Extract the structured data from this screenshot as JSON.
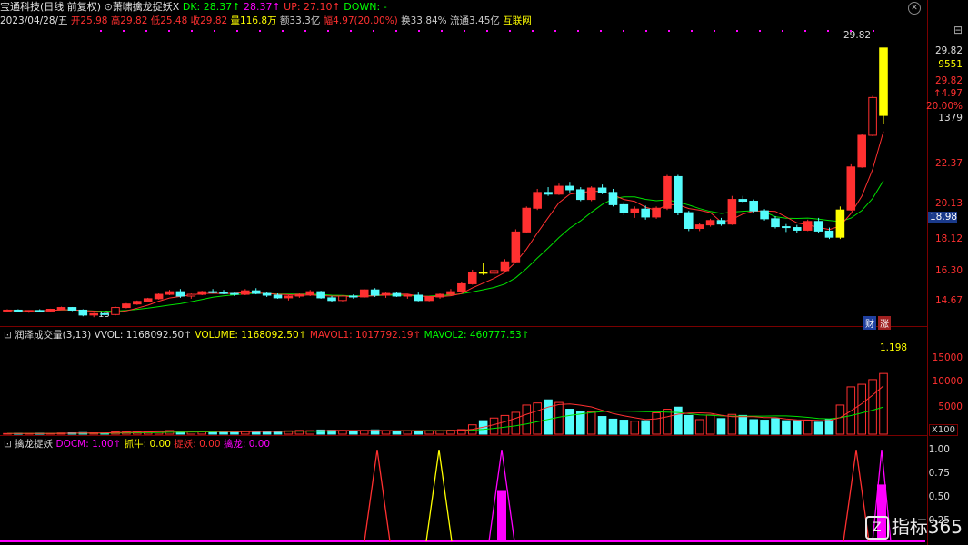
{
  "colors": {
    "up": "#ff3030",
    "down": "#54fcfc",
    "yellow": "#ffff00",
    "magenta": "#ff00ff",
    "green": "#00ff00",
    "grid": "#7a0000",
    "ma1": "#ff3030",
    "ma2": "#00e000"
  },
  "header": {
    "stock": "宝通科技",
    "period": "(日线 前复权)",
    "indicator": "萧啸擒龙捉妖X",
    "dk": "DK: 28.37↑",
    "dk2": "28.37↑",
    "up": "UP: 27.10↑",
    "down": "DOWN: -",
    "date": "2023/04/28/五",
    "open": "开25.98",
    "high": "高29.82",
    "low": "低25.48",
    "close": "收29.82",
    "vol": "量116.8万",
    "amount": "额33.3亿",
    "range": "幅4.97(20.00%)",
    "turnover": "换33.84%",
    "float": "流通3.45亿",
    "sector": "互联网"
  },
  "price_axis": {
    "ticks": [
      "29.82",
      "9551",
      "29.82",
      "↑4.97",
      "20.00%",
      "1379",
      "22.37",
      "20.13",
      "18.12",
      "16.30",
      "14.67"
    ],
    "current": "18.98",
    "top_label": "29.82",
    "marker": "13",
    "badges": [
      "财",
      "涨"
    ]
  },
  "vol_panel": {
    "title": "润泽成交量(3,13)",
    "vvol": "VVOL: 1168092.50↑",
    "volume": "VOLUME: 1168092.50↑",
    "mavol1": "MAVOL1: 1017792.19↑",
    "mavol2": "MAVOL2: 460777.53↑",
    "peak": "1.198",
    "ticks": [
      "15000",
      "10000",
      "5000"
    ],
    "unit": "X100"
  },
  "ind_panel": {
    "title": "擒龙捉妖",
    "docm": "DOCM: 1.00↑",
    "zhuaniu": "抓牛: 0.00",
    "zhuoyao": "捉妖: 0.00",
    "qinlong": "擒龙: 0.00",
    "ticks": [
      "1.00",
      "0.75",
      "0.50",
      "0.25"
    ]
  },
  "watermark": "指标365",
  "chart_data": {
    "type": "candlestick",
    "ohlc": [
      [
        14.85,
        14.95,
        14.8,
        14.9
      ],
      [
        14.9,
        14.95,
        14.78,
        14.82
      ],
      [
        14.82,
        14.9,
        14.75,
        14.88
      ],
      [
        14.88,
        14.95,
        14.8,
        14.85
      ],
      [
        14.85,
        14.98,
        14.82,
        14.95
      ],
      [
        14.95,
        15.1,
        14.9,
        15.05
      ],
      [
        15.05,
        15.08,
        14.85,
        14.9
      ],
      [
        14.9,
        14.95,
        14.55,
        14.62
      ],
      [
        14.62,
        14.75,
        14.5,
        14.7
      ],
      [
        14.7,
        14.8,
        14.6,
        14.65
      ],
      [
        14.65,
        15.1,
        14.6,
        15.05
      ],
      [
        15.05,
        15.3,
        15.0,
        15.25
      ],
      [
        15.25,
        15.45,
        15.2,
        15.4
      ],
      [
        15.4,
        15.6,
        15.35,
        15.55
      ],
      [
        15.55,
        15.85,
        15.5,
        15.8
      ],
      [
        15.8,
        16.05,
        15.75,
        15.95
      ],
      [
        15.95,
        16.1,
        15.6,
        15.7
      ],
      [
        15.7,
        15.85,
        15.55,
        15.8
      ],
      [
        15.8,
        16.0,
        15.75,
        15.95
      ],
      [
        15.95,
        16.1,
        15.85,
        15.9
      ],
      [
        15.9,
        16.05,
        15.8,
        15.85
      ],
      [
        15.85,
        15.95,
        15.7,
        15.8
      ],
      [
        15.8,
        16.1,
        15.75,
        16.0
      ],
      [
        16.0,
        16.15,
        15.8,
        15.85
      ],
      [
        15.85,
        15.95,
        15.65,
        15.75
      ],
      [
        15.75,
        15.85,
        15.55,
        15.6
      ],
      [
        15.6,
        15.75,
        15.45,
        15.7
      ],
      [
        15.7,
        15.85,
        15.6,
        15.8
      ],
      [
        15.8,
        16.05,
        15.7,
        15.95
      ],
      [
        15.95,
        16.0,
        15.55,
        15.6
      ],
      [
        15.6,
        15.7,
        15.35,
        15.45
      ],
      [
        15.45,
        15.75,
        15.4,
        15.7
      ],
      [
        15.7,
        15.8,
        15.55,
        15.65
      ],
      [
        15.65,
        16.1,
        15.6,
        16.05
      ],
      [
        16.05,
        16.15,
        15.65,
        15.75
      ],
      [
        15.75,
        15.9,
        15.6,
        15.85
      ],
      [
        15.85,
        15.95,
        15.65,
        15.7
      ],
      [
        15.7,
        15.8,
        15.55,
        15.75
      ],
      [
        15.75,
        15.9,
        15.4,
        15.45
      ],
      [
        15.45,
        15.7,
        15.4,
        15.65
      ],
      [
        15.65,
        15.85,
        15.55,
        15.8
      ],
      [
        15.8,
        16.1,
        15.7,
        15.95
      ],
      [
        15.95,
        16.5,
        15.9,
        16.4
      ],
      [
        16.4,
        17.2,
        16.35,
        17.05
      ],
      [
        17.05,
        17.6,
        16.9,
        17.0
      ],
      [
        17.0,
        17.2,
        16.85,
        17.15
      ],
      [
        17.15,
        17.8,
        17.05,
        17.65
      ],
      [
        17.65,
        19.5,
        17.6,
        19.35
      ],
      [
        19.35,
        20.8,
        19.3,
        20.7
      ],
      [
        20.7,
        21.8,
        20.6,
        21.6
      ],
      [
        21.6,
        21.9,
        21.4,
        21.5
      ],
      [
        21.5,
        22.1,
        21.45,
        21.95
      ],
      [
        21.95,
        22.2,
        21.6,
        21.75
      ],
      [
        21.75,
        21.9,
        21.1,
        21.2
      ],
      [
        21.2,
        21.95,
        21.1,
        21.85
      ],
      [
        21.85,
        22.05,
        21.5,
        21.6
      ],
      [
        21.6,
        21.8,
        20.8,
        20.9
      ],
      [
        20.9,
        21.05,
        20.3,
        20.45
      ],
      [
        20.45,
        20.8,
        20.15,
        20.65
      ],
      [
        20.65,
        20.85,
        20.05,
        20.2
      ],
      [
        20.2,
        20.8,
        20.1,
        20.7
      ],
      [
        20.7,
        22.6,
        20.6,
        22.5
      ],
      [
        22.5,
        22.6,
        20.3,
        20.45
      ],
      [
        20.45,
        20.55,
        19.4,
        19.55
      ],
      [
        19.55,
        19.85,
        19.4,
        19.75
      ],
      [
        19.75,
        20.1,
        19.65,
        20.0
      ],
      [
        20.0,
        20.15,
        19.7,
        19.8
      ],
      [
        19.8,
        21.4,
        19.75,
        21.2
      ],
      [
        21.2,
        21.4,
        21.0,
        21.1
      ],
      [
        21.1,
        21.2,
        20.45,
        20.55
      ],
      [
        20.55,
        20.65,
        20.0,
        20.1
      ],
      [
        20.1,
        20.25,
        19.55,
        19.65
      ],
      [
        19.65,
        19.8,
        19.35,
        19.6
      ],
      [
        19.6,
        19.75,
        19.3,
        19.45
      ],
      [
        19.45,
        20.05,
        19.4,
        19.95
      ],
      [
        19.95,
        20.15,
        19.3,
        19.4
      ],
      [
        19.4,
        19.6,
        18.95,
        19.05
      ],
      [
        19.05,
        20.8,
        18.95,
        20.6
      ],
      [
        20.6,
        23.2,
        20.55,
        23.05
      ],
      [
        23.05,
        24.95,
        23.0,
        24.85
      ],
      [
        24.85,
        27.1,
        24.8,
        27.0
      ],
      [
        25.98,
        29.82,
        25.48,
        29.82
      ]
    ],
    "volume": [
      120,
      150,
      130,
      180,
      140,
      220,
      260,
      300,
      250,
      200,
      450,
      520,
      480,
      420,
      620,
      700,
      560,
      500,
      530,
      480,
      460,
      450,
      520,
      600,
      550,
      500,
      640,
      720,
      680,
      800,
      760,
      700,
      620,
      700,
      820,
      650,
      600,
      640,
      700,
      620,
      680,
      760,
      880,
      1800,
      2600,
      3100,
      3600,
      4200,
      5600,
      6000,
      6600,
      6100,
      4800,
      4400,
      4300,
      3400,
      2900,
      2700,
      2500,
      2600,
      4100,
      4800,
      5200,
      3600,
      2800,
      3700,
      3000,
      3800,
      3600,
      2800,
      2700,
      3000,
      2600,
      2600,
      2700,
      2300,
      2800,
      5600,
      9100,
      9600,
      10500,
      11680
    ],
    "volume_up": [
      1,
      0,
      1,
      0,
      1,
      1,
      0,
      0,
      1,
      0,
      1,
      1,
      1,
      1,
      1,
      1,
      0,
      1,
      1,
      0,
      0,
      0,
      1,
      0,
      0,
      0,
      1,
      1,
      1,
      0,
      0,
      1,
      0,
      1,
      0,
      1,
      0,
      1,
      0,
      1,
      1,
      1,
      1,
      1,
      0,
      1,
      1,
      1,
      1,
      1,
      0,
      1,
      0,
      0,
      1,
      0,
      0,
      0,
      1,
      0,
      1,
      1,
      0,
      0,
      1,
      1,
      0,
      1,
      0,
      0,
      0,
      0,
      0,
      0,
      1,
      0,
      0,
      1,
      1,
      1,
      1,
      1
    ],
    "docm_x": [
      80,
      95,
      97,
      112,
      202
    ],
    "docm_colors": [
      "#ff3030",
      "#ffff00",
      "#ff00ff",
      "#ff3030",
      "#ff00ff"
    ],
    "ylim_price": [
      14.2,
      31.0
    ],
    "ylim_volume": [
      0,
      18000
    ],
    "ylim_ind": [
      0,
      1.1
    ]
  }
}
